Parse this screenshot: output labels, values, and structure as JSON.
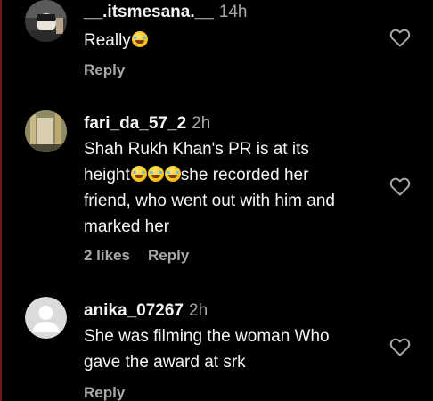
{
  "comments": [
    {
      "username": "__.itsmesana.__",
      "time": "14h",
      "text": "Really",
      "text_lines": [],
      "likes": "",
      "reply_label": "Reply",
      "avatar": "photo-avatar"
    },
    {
      "username": "fari_da_57_2",
      "time": "2h",
      "text_lines": [
        "Shah Rukh Khan's PR is at its",
        "height",
        "she recorded her",
        "friend, who went out with him and",
        "marked her"
      ],
      "likes": "2 likes",
      "reply_label": "Reply",
      "avatar": "photo-avatar"
    },
    {
      "username": "anika_07267",
      "time": "2h",
      "text_lines": [
        "She was filming the woman Who",
        "gave the award at srk"
      ],
      "likes": "",
      "reply_label": "Reply",
      "avatar": "default-avatar"
    }
  ],
  "icons": {
    "like": "heart-outline-icon",
    "emoji": "rolling-on-floor-laughing-emoji"
  },
  "colors": {
    "background": "#000000",
    "primary_text": "#f5f5f5",
    "secondary_text": "#a8a8a8"
  }
}
